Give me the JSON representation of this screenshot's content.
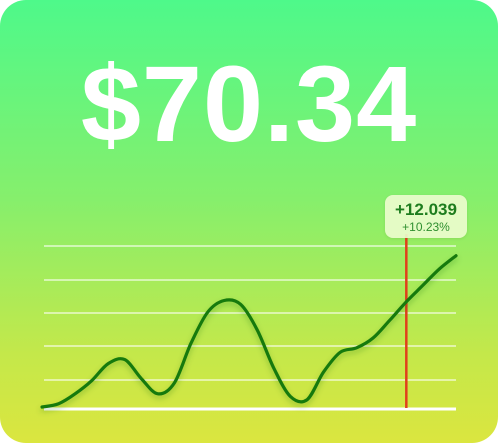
{
  "price": "$70.34",
  "change": {
    "value": "+12.039",
    "percent": "+10.23%"
  },
  "colors": {
    "gradient_top": "#4ef98a",
    "gradient_bottom": "#dbe63f",
    "line": "#157a0d",
    "cursor": "#e0401b",
    "gridline": "#ffffff",
    "badge_bg": "#ecfccd"
  },
  "chart_data": {
    "type": "line",
    "x": [
      0,
      4,
      8,
      12,
      16,
      20,
      24,
      28,
      32,
      36,
      40,
      44,
      48,
      52,
      56,
      60,
      64,
      68,
      72,
      76,
      80,
      84,
      88,
      92,
      96,
      100
    ],
    "values": [
      0.0,
      0.5,
      2.0,
      4.0,
      6.6,
      7.2,
      4.3,
      2.0,
      3.7,
      9.7,
      14.4,
      16.2,
      15.6,
      11.7,
      5.9,
      1.6,
      1.1,
      5.3,
      8.3,
      9.0,
      10.5,
      13.2,
      16.0,
      18.5,
      21.0,
      23.0
    ],
    "ylim": [
      0,
      26
    ],
    "grid": true,
    "cursor_x": 88
  }
}
